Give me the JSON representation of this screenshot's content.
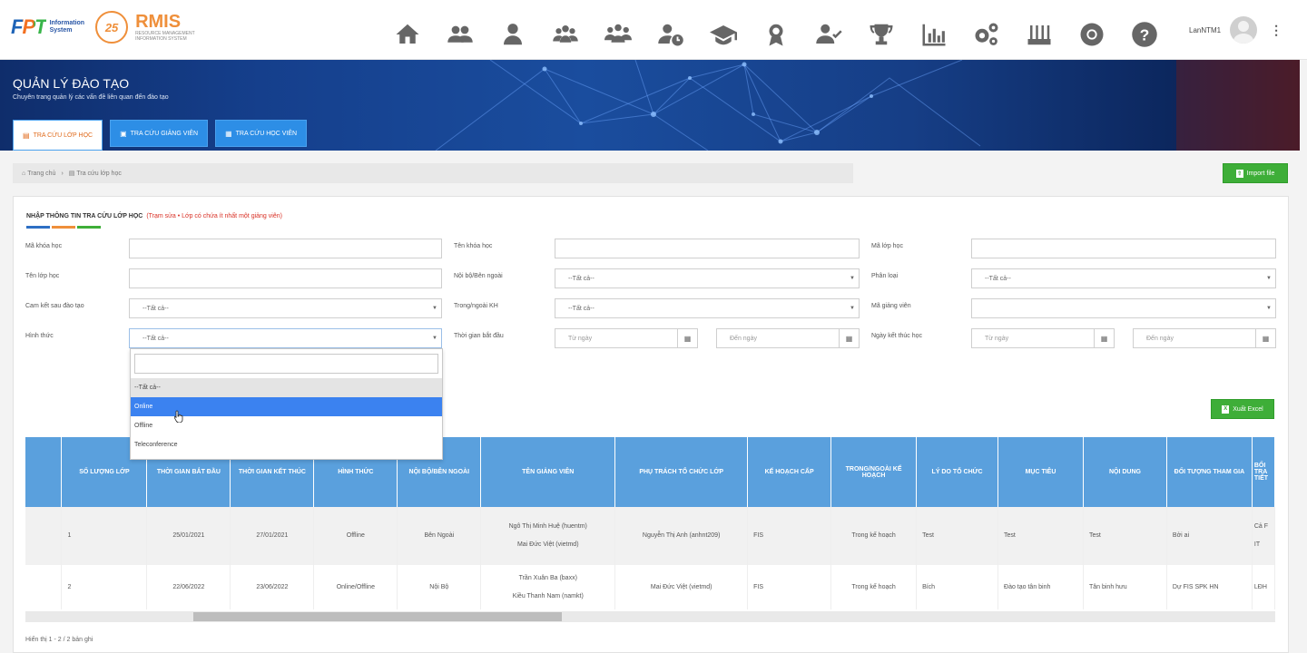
{
  "header": {
    "fpt_logo": "FPT",
    "fpt_subtitle_line1": "Information",
    "fpt_subtitle_line2": "System",
    "rmis_logo": "RMIS",
    "rmis_circle": "25",
    "rmis_subtitle_line1": "RESOURCE MANAGEMENT",
    "rmis_subtitle_line2": "INFORMATION SYSTEM",
    "username": "LanNTM1",
    "nav_icons": [
      "home-icon",
      "users-icon",
      "user-icon",
      "group-settings-icon",
      "team-icon",
      "user-clock-icon",
      "graduation-cap-icon",
      "award-icon",
      "user-check-icon",
      "trophy-icon",
      "bar-chart-icon",
      "gears-icon",
      "network-icon",
      "chrome-icon",
      "help-icon"
    ]
  },
  "banner": {
    "title": "QUẢN LÝ ĐÀO TẠO",
    "subtitle": "Chuyên trang quản lý các vấn đề liên quan đến đào tạo",
    "tabs": [
      "TRA CỨU LỚP HỌC",
      "TRA CỨU GIẢNG VIÊN",
      "TRA CỨU HỌC VIÊN"
    ]
  },
  "breadcrumb": {
    "home": "Trang chủ",
    "current": "Tra cứu lớp học"
  },
  "buttons": {
    "import": "Import file",
    "excel": "Xuất Excel"
  },
  "form": {
    "title": "NHẬP THÔNG TIN TRA CỨU LỚP HỌC",
    "note": "(Trạm sửa • Lớp có chứa ít nhất một giảng viên)",
    "labels": {
      "ma_khoa_hoc": "Mã khóa học",
      "ten_khoa_hoc": "Tên khóa học",
      "ma_lop_hoc": "Mã lớp học",
      "ten_lop_hoc": "Tên lớp học",
      "noi_bo_ben_ngoai": "Nội bộ/Bên ngoài",
      "phan_loai": "Phân loại",
      "cam_ket": "Cam kết sau đào tạo",
      "trong_ngoai_kh": "Trong/ngoài KH",
      "ma_giang_vien": "Mã giảng viên",
      "hinh_thuc": "Hình thức",
      "thoi_gian_bat_dau": "Thời gian bắt đầu",
      "ngay_ket_thuc": "Ngày kết thúc học"
    },
    "select_all": "--Tất cả--",
    "from_date": "Từ ngày",
    "to_date": "Đến ngày"
  },
  "dropdown": {
    "options": [
      "--Tất cả--",
      "Online",
      "Offline",
      "Teleconference"
    ],
    "highlighted": "Online"
  },
  "table": {
    "headers": [
      "",
      "SỐ LƯỢNG LỚP",
      "THỜI GIAN BẮT ĐẦU",
      "THỜI GIAN KẾT THÚC",
      "HÌNH THỨC",
      "NỘI BỘ/BÊN NGOÀI",
      "TÊN GIẢNG VIÊN",
      "PHỤ TRÁCH TỔ CHỨC LỚP",
      "KẾ HOẠCH CẤP",
      "TRONG/NGOÀI KẾ HOẠCH",
      "LÝ DO TỔ CHỨC",
      "MỤC TIÊU",
      "NỘI DUNG",
      "ĐỐI TƯỢNG THAM GIA",
      "BỐI TRA TIẾT"
    ],
    "rows": [
      {
        "cells": [
          "",
          "1",
          "25/01/2021",
          "27/01/2021",
          "Offline",
          "Bên Ngoài",
          "",
          "Nguyễn Thị Anh (anhnt209)",
          "FIS",
          "Trong kế hoạch",
          "Test",
          "Test",
          "Test",
          "Bởi ai",
          "Cả F IT"
        ],
        "teachers": [
          "Ngô Thị Minh Huệ (huentm)",
          "Mai Đức Việt (vietmd)"
        ]
      },
      {
        "cells": [
          "",
          "2",
          "22/06/2022",
          "23/06/2022",
          "Online/Offline",
          "Nội Bộ",
          "",
          "Mai Đức Việt (vietmd)",
          "FIS",
          "Trong kế hoạch",
          "Bích",
          "Đào tạo tân binh",
          "Tân binh hưu",
          "Dự FIS SPK HN",
          "LĐH"
        ],
        "teachers": [
          "Trần Xuân Ba (baxx)",
          "Kiều Thanh Nam (namkt)"
        ]
      }
    ]
  },
  "footer": "Hiển thị 1 - 2 / 2 bản ghi",
  "colors": {
    "accent": "#2d8ee6",
    "header_blue": "#5aa0dd",
    "green": "#3eae38",
    "orange": "#ef8f3a",
    "highlight": "#3b82f0"
  }
}
